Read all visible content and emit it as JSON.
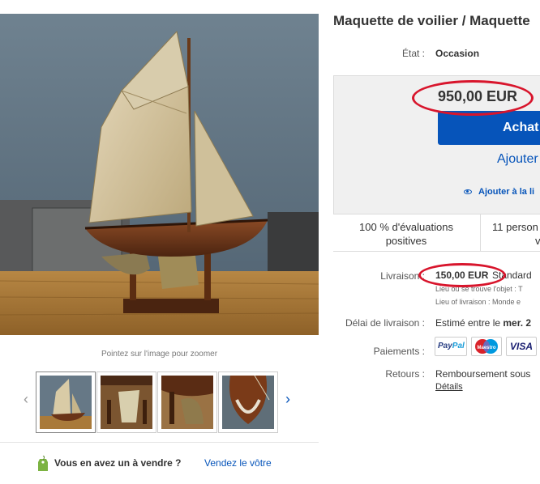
{
  "listing": {
    "title": "Maquette de voilier / Maquette"
  },
  "condition": {
    "label": "État :",
    "value": "Occasion"
  },
  "buybox": {
    "price": "950,00 EUR",
    "buy_now_label": "Achat",
    "add_to_cart_label": "Ajouter",
    "watch_label": "Ajouter à la li",
    "feedback_line1": "100 % d'évaluations",
    "feedback_line2": "positives",
    "people_line1": "11 person",
    "people_line2": "v"
  },
  "shipping": {
    "label": "Livraison :",
    "price": "150,00 EUR",
    "service": "Standard",
    "item_location": "Lieu où se trouve l'objet : T",
    "delivery_location": "Lieu of livraison : Monde e"
  },
  "delivery": {
    "label": "Délai de livraison :",
    "value_prefix": "Estimé entre le",
    "value_bold": "mer. 2"
  },
  "payments": {
    "label": "Paiements :",
    "logos": [
      "PayPal",
      "Maestro",
      "VISA"
    ],
    "paypal_a": "Pay",
    "paypal_b": "Pal",
    "maestro": "Maestro",
    "visa": "VISA"
  },
  "returns": {
    "label": "Retours :",
    "value": "Remboursement sous",
    "details_link": "Détails"
  },
  "gallery": {
    "zoom_hint": "Pointez sur l'image pour zoomer",
    "prev_icon": "chevron-left-icon",
    "next_icon": "chevron-right-icon",
    "prev_glyph": "‹",
    "next_glyph": "›"
  },
  "sell": {
    "question": "Vous en avez un à vendre ?",
    "link": "Vendez le vôtre",
    "icon": "price-tag-icon"
  },
  "colors": {
    "link_blue": "#0654ba",
    "annotation_red": "#d8152c",
    "buybox_bg": "#f0f0f0"
  }
}
